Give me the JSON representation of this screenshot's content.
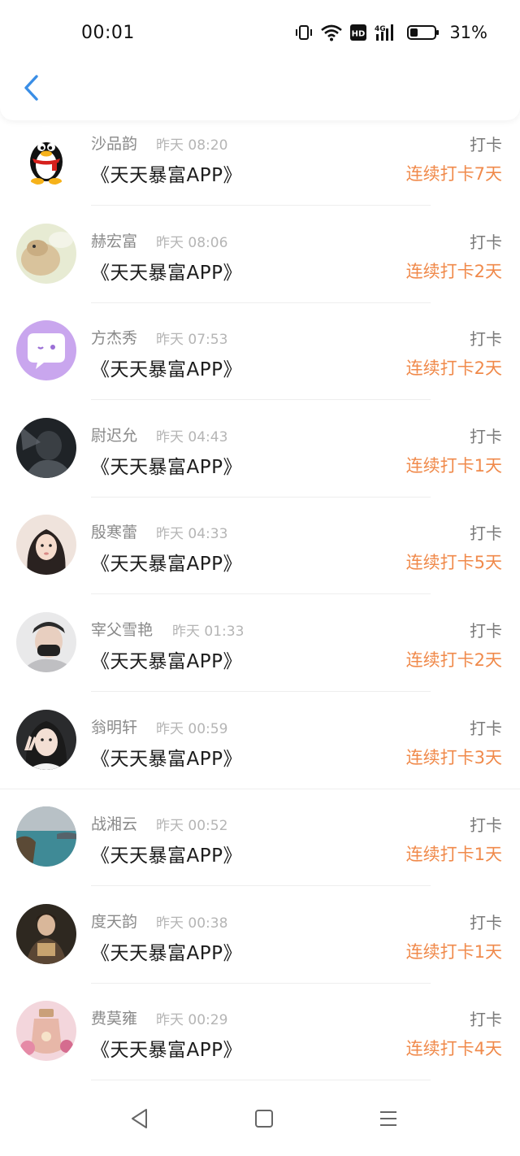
{
  "status_bar": {
    "time": "00:01",
    "battery_percent": "31%",
    "network": "4G",
    "hd_badge": "HD",
    "battery_level": 0.31
  },
  "header": {
    "back_icon": "chevron-left-icon",
    "accent_color": "#3a8ee6"
  },
  "colors": {
    "streak": "#f08a4b",
    "name": "#8a8a8a",
    "time": "#b5b5b5"
  },
  "rows": [
    {
      "name": "沙品韵",
      "time": "昨天 08:20",
      "app": "《天天暴富APP》",
      "action": "打卡",
      "streak": "连续打卡7天",
      "avatar": "qq-penguin"
    },
    {
      "name": "赫宏富",
      "time": "昨天 08:06",
      "app": "《天天暴富APP》",
      "action": "打卡",
      "streak": "连续打卡2天",
      "avatar": "photo-pet"
    },
    {
      "name": "方杰秀",
      "time": "昨天 07:53",
      "app": "《天天暴富APP》",
      "action": "打卡",
      "streak": "连续打卡2天",
      "avatar": "chat-bubble"
    },
    {
      "name": "尉迟允",
      "time": "昨天 04:43",
      "app": "《天天暴富APP》",
      "action": "打卡",
      "streak": "连续打卡1天",
      "avatar": "photo-dark"
    },
    {
      "name": "殷寒蕾",
      "time": "昨天 04:33",
      "app": "《天天暴富APP》",
      "action": "打卡",
      "streak": "连续打卡5天",
      "avatar": "photo-girl"
    },
    {
      "name": "宰父雪艳",
      "time": "昨天 01:33",
      "app": "《天天暴富APP》",
      "action": "打卡",
      "streak": "连续打卡2天",
      "avatar": "photo-mask"
    },
    {
      "name": "翁明轩",
      "time": "昨天 00:59",
      "app": "《天天暴富APP》",
      "action": "打卡",
      "streak": "连续打卡3天",
      "avatar": "photo-peace"
    },
    {
      "name": "战湘云",
      "time": "昨天 00:52",
      "app": "《天天暴富APP》",
      "action": "打卡",
      "streak": "连续打卡1天",
      "avatar": "photo-sea"
    },
    {
      "name": "度天韵",
      "time": "昨天 00:38",
      "app": "《天天暴富APP》",
      "action": "打卡",
      "streak": "连续打卡1天",
      "avatar": "photo-reader"
    },
    {
      "name": "费莫雍",
      "time": "昨天 00:29",
      "app": "《天天暴富APP》",
      "action": "打卡",
      "streak": "连续打卡4天",
      "avatar": "photo-pink"
    }
  ],
  "nav_bar": {
    "back": "triangle-back-icon",
    "home": "square-home-icon",
    "menu": "lines-menu-icon"
  }
}
